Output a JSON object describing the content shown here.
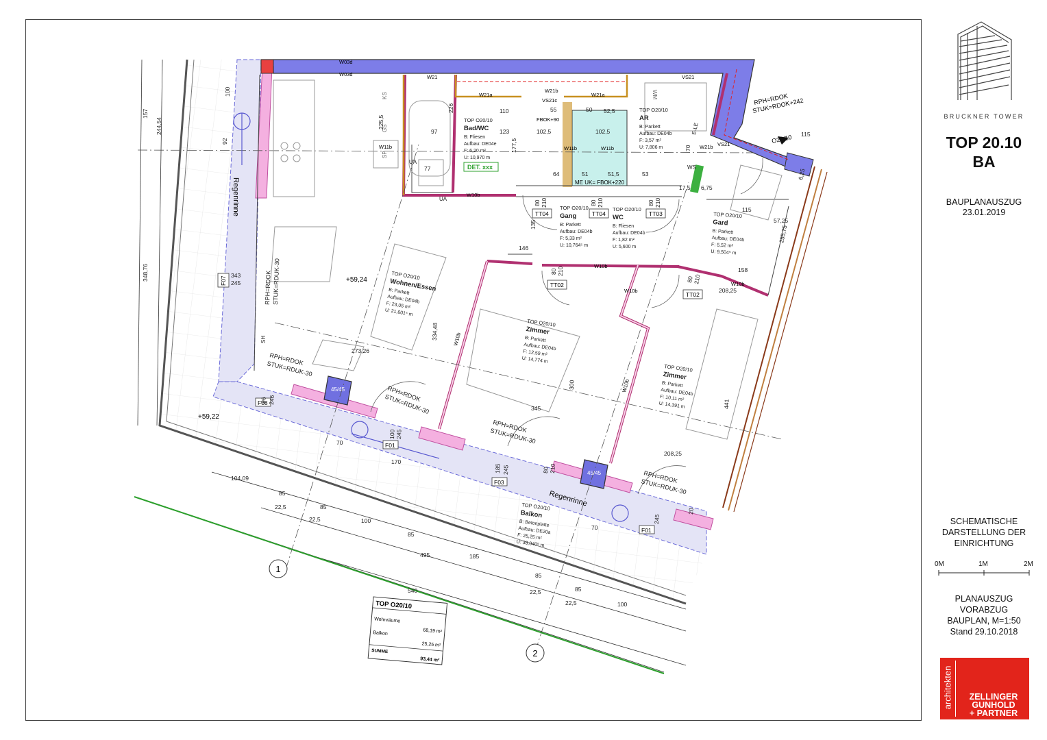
{
  "project": {
    "building": "BRUCKNER TOWER",
    "unit_title_line1": "TOP 20.10",
    "unit_title_line2": "BA"
  },
  "title_block": {
    "extract_line1": "BAUPLANAUSZUG",
    "extract_date": "23.01.2019",
    "schematic_lines": [
      "SCHEMATISCHE",
      "DARSTELLUNG DER",
      "EINRICHTUNG"
    ],
    "scale_labels": [
      "0M",
      "1M",
      "2M"
    ],
    "plan_lines": [
      "PLANAUSZUG",
      "VORABZUG",
      "BAUPLAN, M=1:50",
      "Stand 29.10.2018"
    ],
    "architect_vertical": "architekten",
    "architect_lines": [
      "ZELLINGER",
      "GUNHOLD",
      "+ PARTNER"
    ],
    "logo_color": "#e2241b"
  },
  "rooms": [
    {
      "unit": "TOP O20/10",
      "name": "Bad/WC",
      "lines": [
        "B: Fliesen",
        "Aufbau: DE04e",
        "F: 6,20 m²",
        "U: 10,970 m"
      ]
    },
    {
      "unit": "TOP O20/10",
      "name": "AR",
      "lines": [
        "B: Parkett",
        "Aufbau: DE04b",
        "F: 3,57 m²",
        "U: 7,806 m"
      ]
    },
    {
      "unit": "TOP O20/10",
      "name": "Gang",
      "lines": [
        "B: Parkett",
        "Aufbau: DE04b",
        "F: 5,33 m²",
        "U: 10,764⁵ m"
      ]
    },
    {
      "unit": "TOP O20/10",
      "name": "WC",
      "lines": [
        "B: Fliesen",
        "Aufbau: DE04b",
        "F: 1,82 m²",
        "U: 5,600 m"
      ]
    },
    {
      "unit": "TOP O20/10",
      "name": "Gard",
      "lines": [
        "B: Parkett",
        "Aufbau: DE04b",
        "F: 5,52 m²",
        "U: 9,504⁵ m"
      ]
    },
    {
      "unit": "TOP O20/10",
      "name": "Wohnen/Essen",
      "lines": [
        "B: Parkett",
        "Aufbau: DE04b",
        "F: 23,05 m²",
        "U: 21,601⁵ m"
      ]
    },
    {
      "unit": "TOP O20/10",
      "name": "Zimmer",
      "lines": [
        "B: Parkett",
        "Aufbau: DE04b",
        "F: 12,59 m²",
        "U: 14,774 m"
      ]
    },
    {
      "unit": "TOP O20/10",
      "name": "Zimmer",
      "lines": [
        "B: Parkett",
        "Aufbau: DE04b",
        "F: 10,11 m²",
        "U: 14,391 m"
      ]
    },
    {
      "unit": "TOP O20/10",
      "name": "Balkon",
      "lines": [
        "B: Betonplatte",
        "Aufbau: DE20a",
        "F: 25,25 m²",
        "U: 38,040⁵ m"
      ]
    }
  ],
  "summary_table": {
    "title": "TOP O20/10",
    "rows": [
      {
        "label": "Wohnräume",
        "value": "68,19 m²"
      },
      {
        "label": "Balkon",
        "value": "25,25 m²"
      }
    ],
    "total_label": "SUMME",
    "total_value": "93,44 m²"
  },
  "labels": {
    "regenrinne": "Regenrinne",
    "det": "DET. xxx",
    "me_uk": "ME UK= FBOK+220",
    "fbok": "FBOK+90",
    "stuk242": "STUK=RDOK+242",
    "rph": "RPH=RDOK",
    "stuk30": "STUK=RDUK-30",
    "unit_door": "O20/10",
    "level1": "+59,24",
    "level2": "+59,22",
    "pillar": "45/45",
    "grid_axes": [
      "1",
      "2"
    ],
    "windows": [
      "F07",
      "F08",
      "F01",
      "F03",
      "F01"
    ],
    "doors": [
      "TT04",
      "TT04",
      "TT03",
      "TT02",
      "TT02"
    ],
    "walls": [
      "W03d",
      "W03d",
      "W21",
      "W21a",
      "W21b",
      "W21a",
      "VS21",
      "VS21c",
      "W11b",
      "W11b",
      "W11b",
      "W10b",
      "W10b",
      "W10b",
      "W10b",
      "W10b",
      "W21b",
      "VS21"
    ],
    "dims": [
      "157",
      "244,54",
      "100",
      "92",
      "348,76",
      "343",
      "245",
      "146",
      "334,48",
      "273,26",
      "300",
      "345",
      "104,09",
      "85",
      "22,5",
      "85",
      "22,5",
      "100",
      "85",
      "495",
      "185",
      "540",
      "85",
      "22,5",
      "85",
      "22,5",
      "100",
      "170",
      "70",
      "100",
      "245",
      "185",
      "245",
      "208,25",
      "441",
      "208,25",
      "158",
      "115",
      "57,25",
      "255,75",
      "115",
      "110",
      "97",
      "123",
      "102,5",
      "102,5",
      "52,5",
      "55",
      "50",
      "64",
      "51",
      "51,5",
      "53",
      "80",
      "210",
      "80",
      "210",
      "80",
      "210",
      "80",
      "210",
      "80",
      "210",
      "70",
      "6,25",
      "6,75",
      "17,5",
      "226",
      "225,5",
      "177,5",
      "77",
      "96",
      "246",
      "70",
      "20",
      "245",
      "80",
      "210",
      "135"
    ],
    "misc": [
      "KS",
      "GS",
      "SP",
      "UA",
      "SH",
      "WM",
      "WS",
      "E-LE",
      "DET"
    ]
  }
}
